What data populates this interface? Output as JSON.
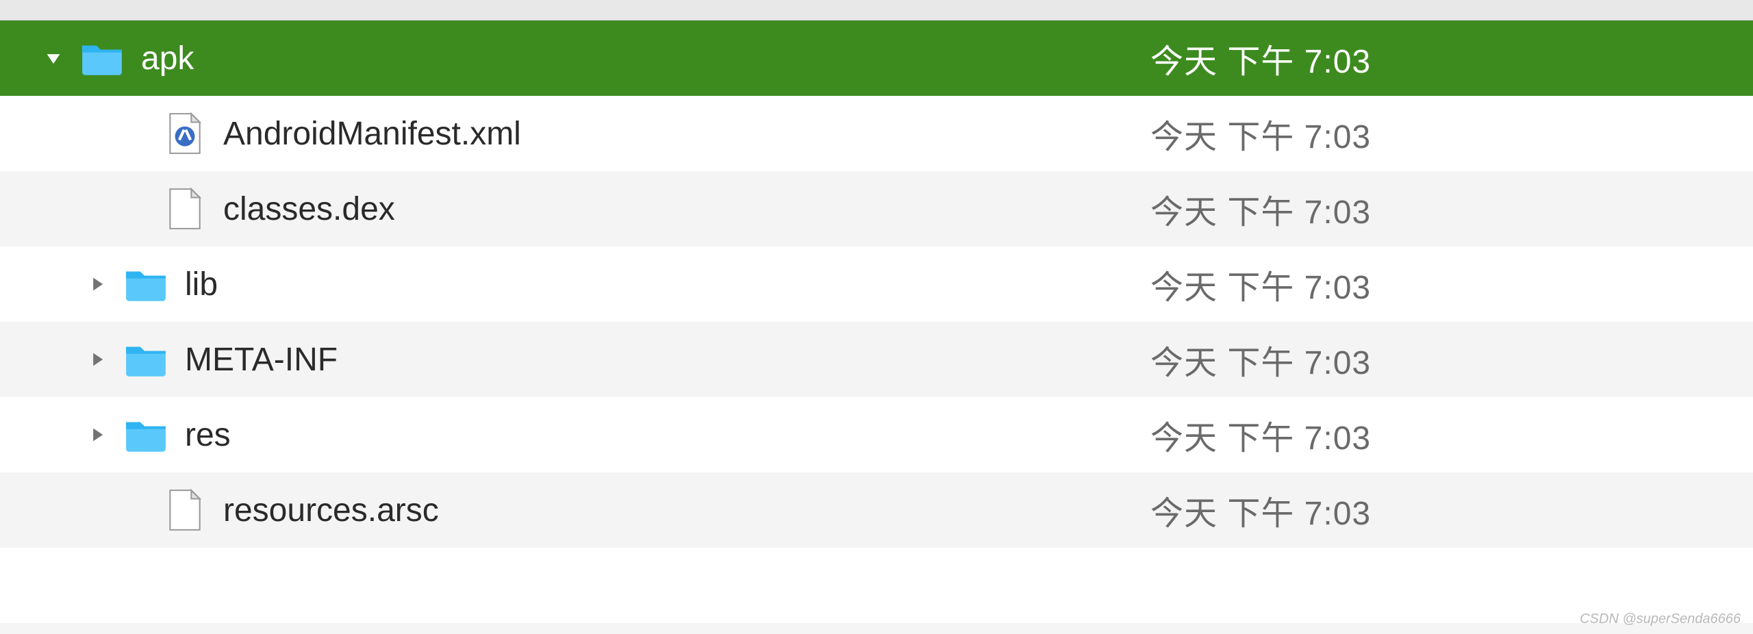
{
  "rows": [
    {
      "name": "apk",
      "date": "今天 下午 7:03",
      "type": "folder",
      "expanded": true,
      "selected": true,
      "level": 1
    },
    {
      "name": "AndroidManifest.xml",
      "date": "今天 下午 7:03",
      "type": "xml",
      "expanded": null,
      "selected": false,
      "level": 2
    },
    {
      "name": "classes.dex",
      "date": "今天 下午 7:03",
      "type": "file",
      "expanded": null,
      "selected": false,
      "level": 2
    },
    {
      "name": "lib",
      "date": "今天 下午 7:03",
      "type": "folder",
      "expanded": false,
      "selected": false,
      "level": 2
    },
    {
      "name": "META-INF",
      "date": "今天 下午 7:03",
      "type": "folder",
      "expanded": false,
      "selected": false,
      "level": 2
    },
    {
      "name": "res",
      "date": "今天 下午 7:03",
      "type": "folder",
      "expanded": false,
      "selected": false,
      "level": 2
    },
    {
      "name": "resources.arsc",
      "date": "今天 下午 7:03",
      "type": "file",
      "expanded": null,
      "selected": false,
      "level": 2
    }
  ],
  "watermark": "CSDN @superSenda6666"
}
